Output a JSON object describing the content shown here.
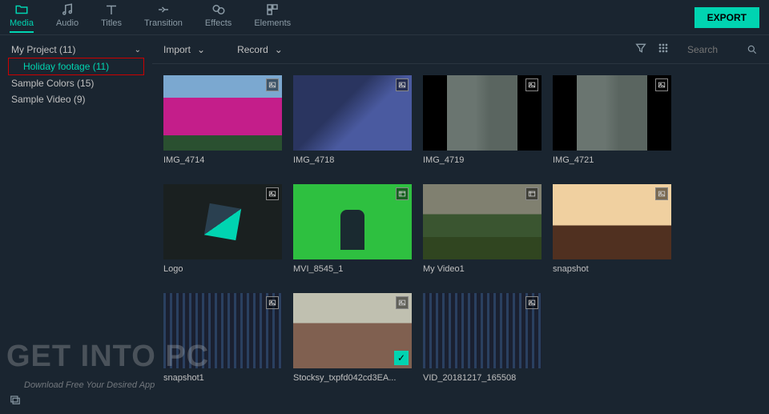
{
  "topbar": {
    "tabs": [
      {
        "label": "Media",
        "icon": "folder-icon",
        "active": true
      },
      {
        "label": "Audio",
        "icon": "music-icon"
      },
      {
        "label": "Titles",
        "icon": "text-icon"
      },
      {
        "label": "Transition",
        "icon": "transition-icon"
      },
      {
        "label": "Effects",
        "icon": "effects-icon"
      },
      {
        "label": "Elements",
        "icon": "elements-icon"
      }
    ],
    "export_label": "EXPORT"
  },
  "sidebar": {
    "root": "My Project (11)",
    "child": "Holiday footage (11)",
    "sample_colors": "Sample Colors (15)",
    "sample_video": "Sample Video (9)"
  },
  "toolbar": {
    "import_label": "Import",
    "record_label": "Record",
    "search_placeholder": "Search"
  },
  "media": [
    {
      "name": "IMG_4714",
      "type": "image",
      "thumb": "thumb-flowers"
    },
    {
      "name": "IMG_4718",
      "type": "image",
      "thumb": "thumb-event"
    },
    {
      "name": "IMG_4719",
      "type": "image",
      "thumb": "thumb-street"
    },
    {
      "name": "IMG_4721",
      "type": "image",
      "thumb": "thumb-street"
    },
    {
      "name": "Logo",
      "type": "image",
      "thumb": "thumb-logo"
    },
    {
      "name": "MVI_8545_1",
      "type": "video",
      "thumb": "thumb-green"
    },
    {
      "name": "My Video1",
      "type": "video",
      "thumb": "thumb-river"
    },
    {
      "name": "snapshot",
      "type": "image",
      "thumb": "thumb-beach"
    },
    {
      "name": "snapshot1",
      "type": "image",
      "thumb": "thumb-timeline"
    },
    {
      "name": "Stocksy_txpfd042cd3EA...",
      "type": "image",
      "thumb": "thumb-people",
      "checked": true
    },
    {
      "name": "VID_20181217_165508",
      "type": "image",
      "thumb": "thumb-timeline"
    }
  ],
  "watermark": {
    "main": "GET INTO PC",
    "sub": "Download Free Your Desired App"
  }
}
